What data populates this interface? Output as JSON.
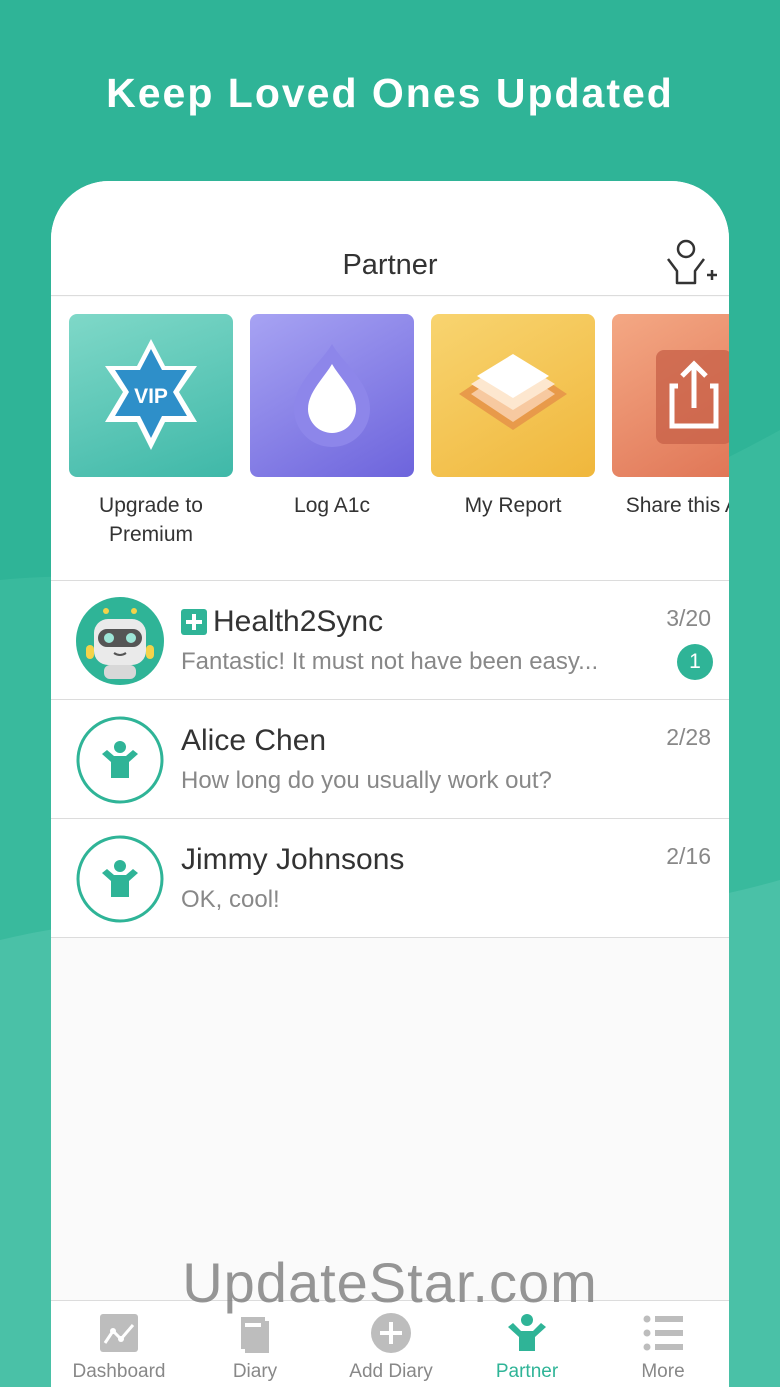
{
  "headline": "Keep Loved Ones Updated",
  "navbar": {
    "title": "Partner"
  },
  "shortcuts": [
    {
      "label": "Upgrade to\nPremium",
      "icon": "vip-star-icon",
      "badge": "VIP"
    },
    {
      "label": "Log A1c",
      "icon": "droplet-icon"
    },
    {
      "label": "My Report",
      "icon": "layers-icon"
    },
    {
      "label": "Share this App",
      "icon": "share-icon"
    }
  ],
  "conversations": [
    {
      "name": "Health2Sync",
      "message": "Fantastic! It must not have been easy...",
      "date": "3/20",
      "unread": "1",
      "avatar": "robot-avatar-icon"
    },
    {
      "name": "Alice Chen",
      "message": "How long do you usually work out?",
      "date": "2/28",
      "avatar": "partner-avatar-icon"
    },
    {
      "name": "Jimmy Johnsons",
      "message": "OK, cool!",
      "date": "2/16",
      "avatar": "partner-avatar-icon"
    }
  ],
  "tabs": [
    {
      "label": "Dashboard",
      "icon": "dashboard-icon"
    },
    {
      "label": "Diary",
      "icon": "diary-book-icon"
    },
    {
      "label": "Add Diary",
      "icon": "add-circle-icon"
    },
    {
      "label": "Partner",
      "icon": "partner-icon",
      "active": true
    },
    {
      "label": "More",
      "icon": "list-icon"
    }
  ],
  "watermark": "UpdateStar.com",
  "colors": {
    "accent": "#2fb497",
    "text": "#333333",
    "muted": "#888888"
  }
}
